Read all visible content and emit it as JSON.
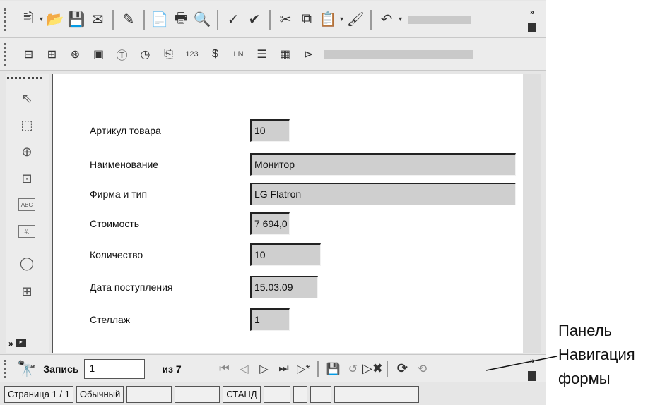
{
  "toolbar_top": {
    "buttons": [
      {
        "name": "edit-file-icon",
        "glyph": "🖹"
      },
      {
        "name": "open-icon",
        "glyph": "📂"
      },
      {
        "name": "save-icon",
        "glyph": "💾"
      },
      {
        "name": "email-icon",
        "glyph": "✉"
      },
      {
        "name": "edit-mode-icon",
        "glyph": "✎"
      },
      {
        "name": "export-pdf-icon",
        "glyph": "📄"
      },
      {
        "name": "print-icon",
        "glyph": "🖶"
      },
      {
        "name": "print-preview-icon",
        "glyph": "🔍"
      },
      {
        "name": "spellcheck-icon",
        "glyph": "✓"
      },
      {
        "name": "autospellcheck-icon",
        "glyph": "✔"
      },
      {
        "name": "cut-icon",
        "glyph": "✂"
      },
      {
        "name": "copy-icon",
        "glyph": "⧉"
      },
      {
        "name": "paste-icon",
        "glyph": "📋"
      },
      {
        "name": "format-paintbrush-icon",
        "glyph": "🖌"
      },
      {
        "name": "undo-icon",
        "glyph": "↶"
      }
    ],
    "more_label": "»"
  },
  "toolbar_form": {
    "buttons": [
      {
        "name": "form-control-icon",
        "glyph": "⊟"
      },
      {
        "name": "form-design-icon",
        "glyph": "⊞"
      },
      {
        "name": "combo-box-icon",
        "glyph": "⊛"
      },
      {
        "name": "image-control-icon",
        "glyph": "▣"
      },
      {
        "name": "text-box-icon",
        "glyph": "Ⓣ"
      },
      {
        "name": "time-field-icon",
        "glyph": "◷"
      },
      {
        "name": "file-selection-icon",
        "glyph": "⎘"
      },
      {
        "name": "numeric-field-icon",
        "glyph": "123"
      },
      {
        "name": "currency-field-icon",
        "glyph": "$"
      },
      {
        "name": "pattern-field-icon",
        "glyph": "LN"
      },
      {
        "name": "group-box-icon",
        "glyph": "☰"
      },
      {
        "name": "table-control-icon",
        "glyph": "▦"
      },
      {
        "name": "navigation-bar-icon",
        "glyph": "⊳"
      }
    ]
  },
  "left_tools": [
    {
      "name": "select-icon",
      "glyph": "⇖",
      "text": false
    },
    {
      "name": "design-mode-icon",
      "glyph": "⬚",
      "text": false
    },
    {
      "name": "controls-icon",
      "glyph": "⊕",
      "text": false
    },
    {
      "name": "form-properties-icon",
      "glyph": "⊡",
      "text": false
    },
    {
      "name": "text-field-icon",
      "glyph": "ABC",
      "text": true
    },
    {
      "name": "formatted-field-icon",
      "glyph": "#.",
      "text": true
    },
    {
      "name": "button-control-icon",
      "glyph": "◯",
      "text": false
    },
    {
      "name": "form-navigator-icon",
      "glyph": "⊞",
      "text": false
    }
  ],
  "form": {
    "fields": [
      {
        "name": "article",
        "label": "Артикул товара",
        "value": "10"
      },
      {
        "name": "name",
        "label": "Наименование",
        "value": "Монитор"
      },
      {
        "name": "firm-type",
        "label": "Фирма и тип",
        "value": "LG Flatron"
      },
      {
        "name": "cost",
        "label": "Стоимость",
        "value": "7 694,0"
      },
      {
        "name": "quantity",
        "label": "Количество",
        "value": "10"
      },
      {
        "name": "arrival-date",
        "label": "Дата поступления",
        "value": "15.03.09"
      },
      {
        "name": "rack",
        "label": "Стеллаж",
        "value": "1"
      }
    ]
  },
  "navigation": {
    "record_label": "Запись",
    "record_value": "1",
    "of_label": "из 7",
    "buttons": [
      {
        "name": "first-record-icon",
        "glyph": "⏮",
        "dim": true
      },
      {
        "name": "prev-record-icon",
        "glyph": "◁",
        "dim": true
      },
      {
        "name": "next-record-icon",
        "glyph": "▷",
        "dim": false
      },
      {
        "name": "last-record-icon",
        "glyph": "⏭",
        "dim": false
      },
      {
        "name": "new-record-icon",
        "glyph": "▷*",
        "dim": false
      },
      {
        "name": "save-record-icon",
        "glyph": "💾",
        "dim": true
      },
      {
        "name": "undo-record-icon",
        "glyph": "↺",
        "dim": true
      },
      {
        "name": "delete-record-icon",
        "glyph": "▷✖",
        "dim": false
      },
      {
        "name": "refresh-icon",
        "glyph": "⟳",
        "dim": false
      },
      {
        "name": "refresh-control-icon",
        "glyph": "⟲",
        "dim": true
      }
    ]
  },
  "statusbar": {
    "page": "Страница 1 / 1",
    "style": "Обычный",
    "mode": "СТАНД"
  },
  "annotation": {
    "line1": "Панель",
    "line2": "Навигация",
    "line3": "формы"
  }
}
